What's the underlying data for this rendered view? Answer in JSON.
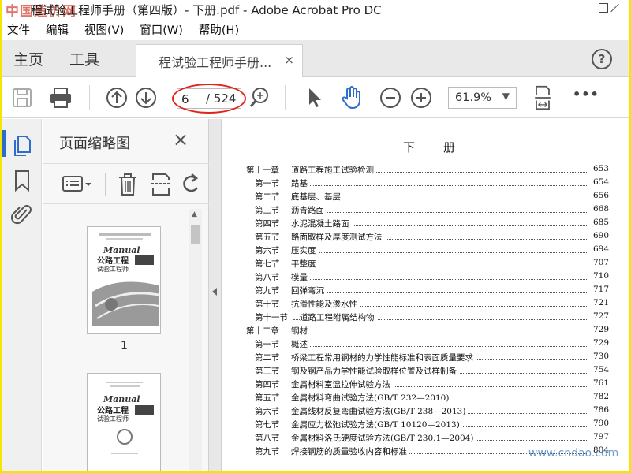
{
  "window": {
    "title": "程试验工程师手册（第四版）- 下册.pdf - Adobe Acrobat Pro DC",
    "watermark": "中国造价网"
  },
  "menu": [
    "文件",
    "编辑",
    "视图(V)",
    "窗口(W)",
    "帮助(H)"
  ],
  "tabs": {
    "home": "主页",
    "tools": "工具",
    "document": "程试验工程师手册...",
    "close": "×",
    "help": "?"
  },
  "toolbar": {
    "current_page": "6",
    "total_pages": "/ 524",
    "zoom": "61.9%",
    "more": "•••"
  },
  "thumbnails": {
    "header": "页面缩略图",
    "close": "×",
    "page1_number": "1"
  },
  "document": {
    "heading": "下册",
    "toc": [
      {
        "sec": "第十一章",
        "title": "道路工程施工试验检测",
        "page": "653",
        "level": 1
      },
      {
        "sec": "第一节",
        "title": "路基",
        "page": "654",
        "level": 2
      },
      {
        "sec": "第二节",
        "title": "底基层、基层",
        "page": "656",
        "level": 2
      },
      {
        "sec": "第三节",
        "title": "沥青路面",
        "page": "668",
        "level": 2
      },
      {
        "sec": "第四节",
        "title": "水泥混凝土路面",
        "page": "685",
        "level": 2
      },
      {
        "sec": "第五节",
        "title": "路面取样及厚度测试方法",
        "page": "690",
        "level": 2
      },
      {
        "sec": "第六节",
        "title": "压实度",
        "page": "694",
        "level": 2
      },
      {
        "sec": "第七节",
        "title": "平整度",
        "page": "707",
        "level": 2
      },
      {
        "sec": "第八节",
        "title": "模量",
        "page": "710",
        "level": 2
      },
      {
        "sec": "第九节",
        "title": "回弹弯沉",
        "page": "717",
        "level": 2
      },
      {
        "sec": "第十节",
        "title": "抗滑性能及渗水性",
        "page": "721",
        "level": 2
      },
      {
        "sec": "第十一节",
        "title": "道路工程附属结构物",
        "page": "727",
        "level": 2
      },
      {
        "sec": "第十二章",
        "title": "钢材",
        "page": "729",
        "level": 1
      },
      {
        "sec": "第一节",
        "title": "概述",
        "page": "729",
        "level": 2
      },
      {
        "sec": "第二节",
        "title": "桥梁工程常用钢材的力学性能标准和表面质量要求",
        "page": "730",
        "level": 2
      },
      {
        "sec": "第三节",
        "title": "钢及钢产品力学性能试验取样位置及试样制备",
        "page": "754",
        "level": 2
      },
      {
        "sec": "第四节",
        "title": "金属材料室温拉伸试验方法",
        "page": "761",
        "level": 2
      },
      {
        "sec": "第五节",
        "title": "金属材料弯曲试验方法(GB/T 232—2010)",
        "page": "782",
        "level": 2
      },
      {
        "sec": "第六节",
        "title": "金属线材反复弯曲试验方法(GB/T 238—2013)",
        "page": "786",
        "level": 2
      },
      {
        "sec": "第七节",
        "title": "金属应力松弛试验方法(GB/T 10120—2013)",
        "page": "790",
        "level": 2
      },
      {
        "sec": "第八节",
        "title": "金属材料洛氏硬度试验方法(GB/T 230.1—2004)",
        "page": "797",
        "level": 2
      },
      {
        "sec": "第九节",
        "title": "焊接钢筋的质量验收内容和标准",
        "page": "804",
        "level": 2
      }
    ],
    "footer_watermark": "www.cndao.com"
  },
  "colors": {
    "accent": "#2d6ecc",
    "highlight": "#e0241b",
    "border": "#f5e600"
  }
}
